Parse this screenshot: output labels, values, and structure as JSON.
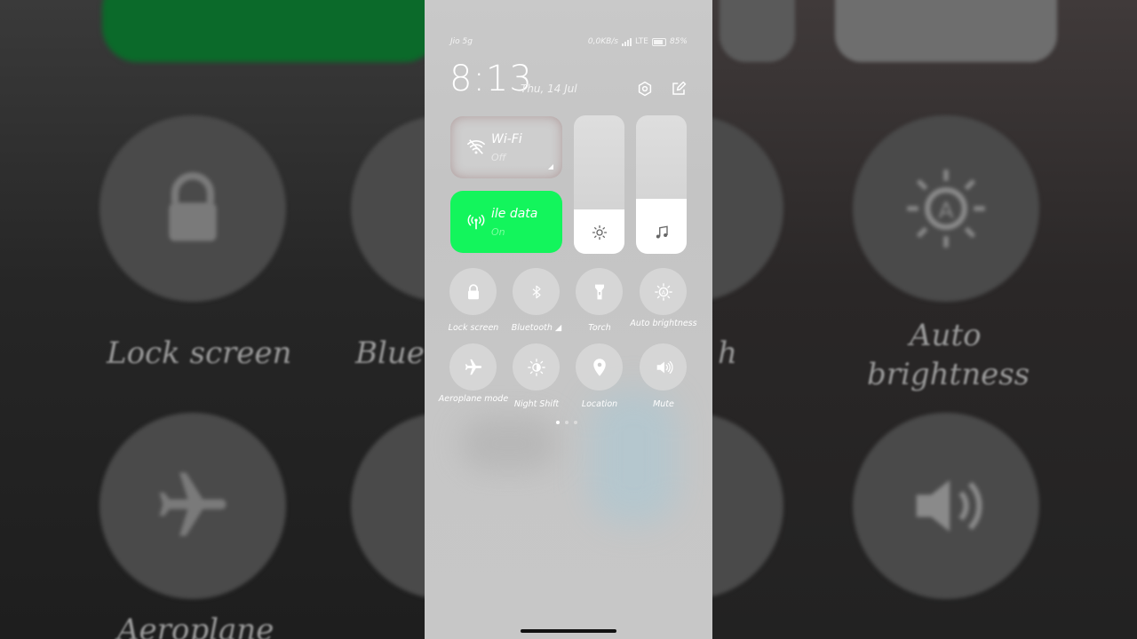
{
  "status_bar": {
    "carrier": "Jio 5g",
    "speed": "0,0KB/s",
    "network": "LTE",
    "battery": "85%"
  },
  "header": {
    "time": "8:13",
    "date": "Thu, 14 Jul",
    "settings_icon": "gear-icon",
    "edit_icon": "edit-icon"
  },
  "tiles": {
    "wifi": {
      "title": "Wi-Fi",
      "status": "Off",
      "icon": "wifi-off-icon"
    },
    "mobile_data": {
      "title": "Mobile data",
      "visible_title": "ile data",
      "status": "On",
      "icon": "antenna-icon",
      "color": "#13f55c"
    }
  },
  "sliders": {
    "brightness": {
      "level": 0.32,
      "icon": "sun-icon"
    },
    "volume": {
      "level": 0.4,
      "icon": "music-note-icon"
    }
  },
  "toggles": [
    {
      "label": "Lock screen",
      "icon": "lock-icon"
    },
    {
      "label": "Bluetooth",
      "icon": "bluetooth-icon"
    },
    {
      "label": "Torch",
      "icon": "torch-icon"
    },
    {
      "label": "Auto brightness",
      "icon": "auto-brightness-icon"
    },
    {
      "label": "Aeroplane mode",
      "icon": "airplane-icon"
    },
    {
      "label": "Night Shift",
      "icon": "night-shift-icon"
    },
    {
      "label": "Location",
      "icon": "location-icon"
    },
    {
      "label": "Mute",
      "icon": "speaker-icon"
    }
  ],
  "page_indicator": {
    "pages": 3,
    "current": 1
  },
  "background_labels": {
    "lock": "Lock screen",
    "bluetooth": "Blue",
    "torch_partial": "h",
    "auto_line1": "Auto",
    "auto_line2": "brightness",
    "aeroplane": "Aeroplane"
  }
}
